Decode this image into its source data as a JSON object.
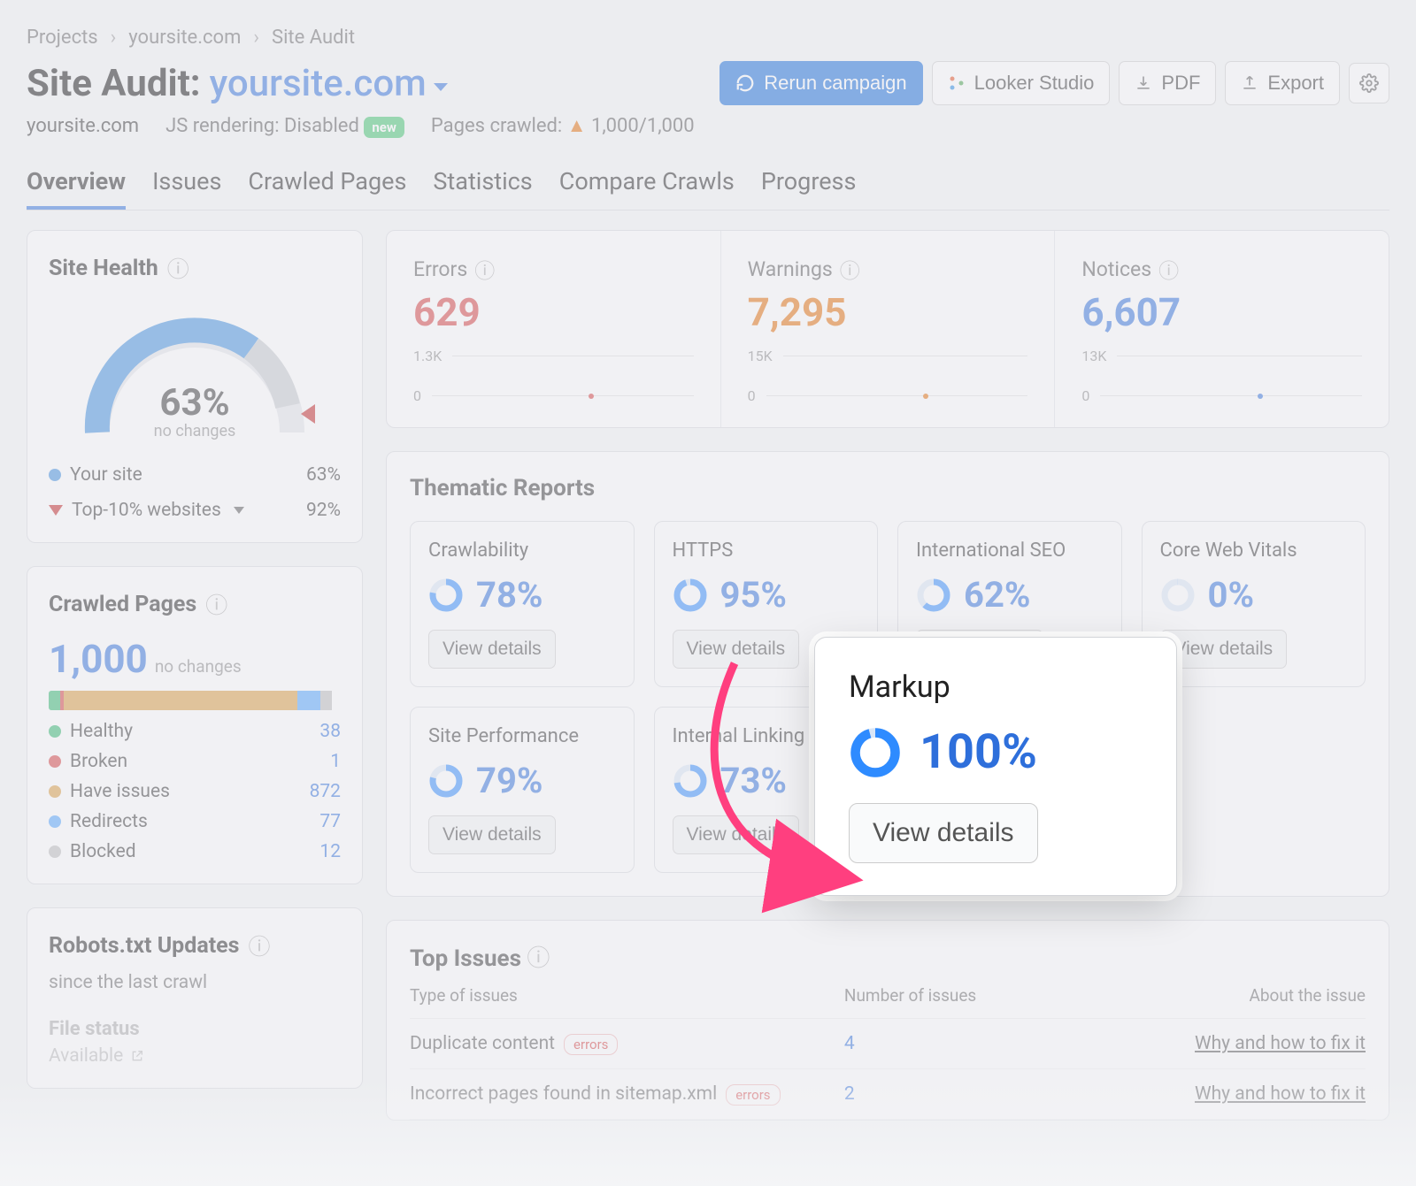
{
  "breadcrumb": [
    "Projects",
    "yoursite.com",
    "Site Audit"
  ],
  "title": "Site Audit:",
  "domain": "yoursite.com",
  "buttons": {
    "rerun": "Rerun campaign",
    "looker": "Looker Studio",
    "pdf": "PDF",
    "export": "Export"
  },
  "subhead": {
    "domain": "yoursite.com",
    "js_label": "JS rendering: Disabled",
    "new_pill": "new",
    "pages_label": "Pages crawled:",
    "pages_value": "1,000/1,000"
  },
  "tabs": [
    "Overview",
    "Issues",
    "Crawled Pages",
    "Statistics",
    "Compare Crawls",
    "Progress"
  ],
  "site_health": {
    "title": "Site Health",
    "pct": "63%",
    "sub": "no changes",
    "legend": [
      {
        "label": "Your site",
        "value": "63%"
      },
      {
        "label": "Top-10% websites",
        "value": "92%"
      }
    ]
  },
  "crawled_pages": {
    "title": "Crawled Pages",
    "value": "1,000",
    "sub": "no changes",
    "legend": [
      {
        "color": "green",
        "label": "Healthy",
        "value": "38"
      },
      {
        "color": "red",
        "label": "Broken",
        "value": "1"
      },
      {
        "color": "orange",
        "label": "Have issues",
        "value": "872"
      },
      {
        "color": "lblue",
        "label": "Redirects",
        "value": "77"
      },
      {
        "color": "grey",
        "label": "Blocked",
        "value": "12"
      }
    ]
  },
  "stats": [
    {
      "title": "Errors",
      "value": "629",
      "class": "red",
      "axis_top": "1.3K",
      "axis_bot": "0",
      "dot_color": "#d63b3b",
      "dot_x": 60
    },
    {
      "title": "Warnings",
      "value": "7,295",
      "class": "orange",
      "axis_top": "15K",
      "axis_bot": "0",
      "dot_color": "#e56a00",
      "dot_x": 60
    },
    {
      "title": "Notices",
      "value": "6,607",
      "class": "blue",
      "axis_top": "13K",
      "axis_bot": "0",
      "dot_color": "#2e6fdb",
      "dot_x": 60
    }
  ],
  "thematic": {
    "title": "Thematic Reports",
    "cards": [
      {
        "title": "Crawlability",
        "pct": "78%",
        "fill": 78
      },
      {
        "title": "HTTPS",
        "pct": "95%",
        "fill": 95
      },
      {
        "title": "International SEO",
        "pct": "62%",
        "fill": 62
      },
      {
        "title": "Core Web Vitals",
        "pct": "0%",
        "fill": 0
      },
      {
        "title": "Site Performance",
        "pct": "79%",
        "fill": 79
      },
      {
        "title": "Internal Linking",
        "pct": "73%",
        "fill": 73
      }
    ],
    "view": "View details"
  },
  "callout": {
    "title": "Markup",
    "pct": "100%",
    "btn": "View details"
  },
  "robots": {
    "title": "Robots.txt Updates",
    "sub": "since the last crawl",
    "file_label": "File status",
    "avail": "Available"
  },
  "top_issues": {
    "title": "Top Issues",
    "cols": {
      "type": "Type of issues",
      "num": "Number of issues",
      "about": "About the issue"
    },
    "rows": [
      {
        "type": "Duplicate content",
        "tag": "errors",
        "num": "4",
        "about": "Why and how to fix it"
      },
      {
        "type": "Incorrect pages found in sitemap.xml",
        "tag": "errors",
        "num": "2",
        "about": "Why and how to fix it"
      }
    ]
  },
  "chart_data": {
    "site_health_gauge": {
      "type": "gauge",
      "value": 63,
      "range": [
        0,
        100
      ],
      "benchmark": 92
    },
    "crawled_bar": {
      "type": "bar",
      "total": 1000,
      "series": [
        {
          "name": "Healthy",
          "value": 38
        },
        {
          "name": "Broken",
          "value": 1
        },
        {
          "name": "Have issues",
          "value": 872
        },
        {
          "name": "Redirects",
          "value": 77
        },
        {
          "name": "Blocked",
          "value": 12
        }
      ]
    },
    "stat_sparklines": [
      {
        "name": "Errors",
        "ylim": [
          0,
          1300
        ],
        "point": 629
      },
      {
        "name": "Warnings",
        "ylim": [
          0,
          15000
        ],
        "point": 7295
      },
      {
        "name": "Notices",
        "ylim": [
          0,
          13000
        ],
        "point": 6607
      }
    ],
    "thematic_donuts": {
      "type": "pie",
      "series": [
        {
          "name": "Crawlability",
          "value": 78
        },
        {
          "name": "HTTPS",
          "value": 95
        },
        {
          "name": "International SEO",
          "value": 62
        },
        {
          "name": "Core Web Vitals",
          "value": 0
        },
        {
          "name": "Site Performance",
          "value": 79
        },
        {
          "name": "Internal Linking",
          "value": 73
        },
        {
          "name": "Markup",
          "value": 100
        }
      ]
    }
  }
}
